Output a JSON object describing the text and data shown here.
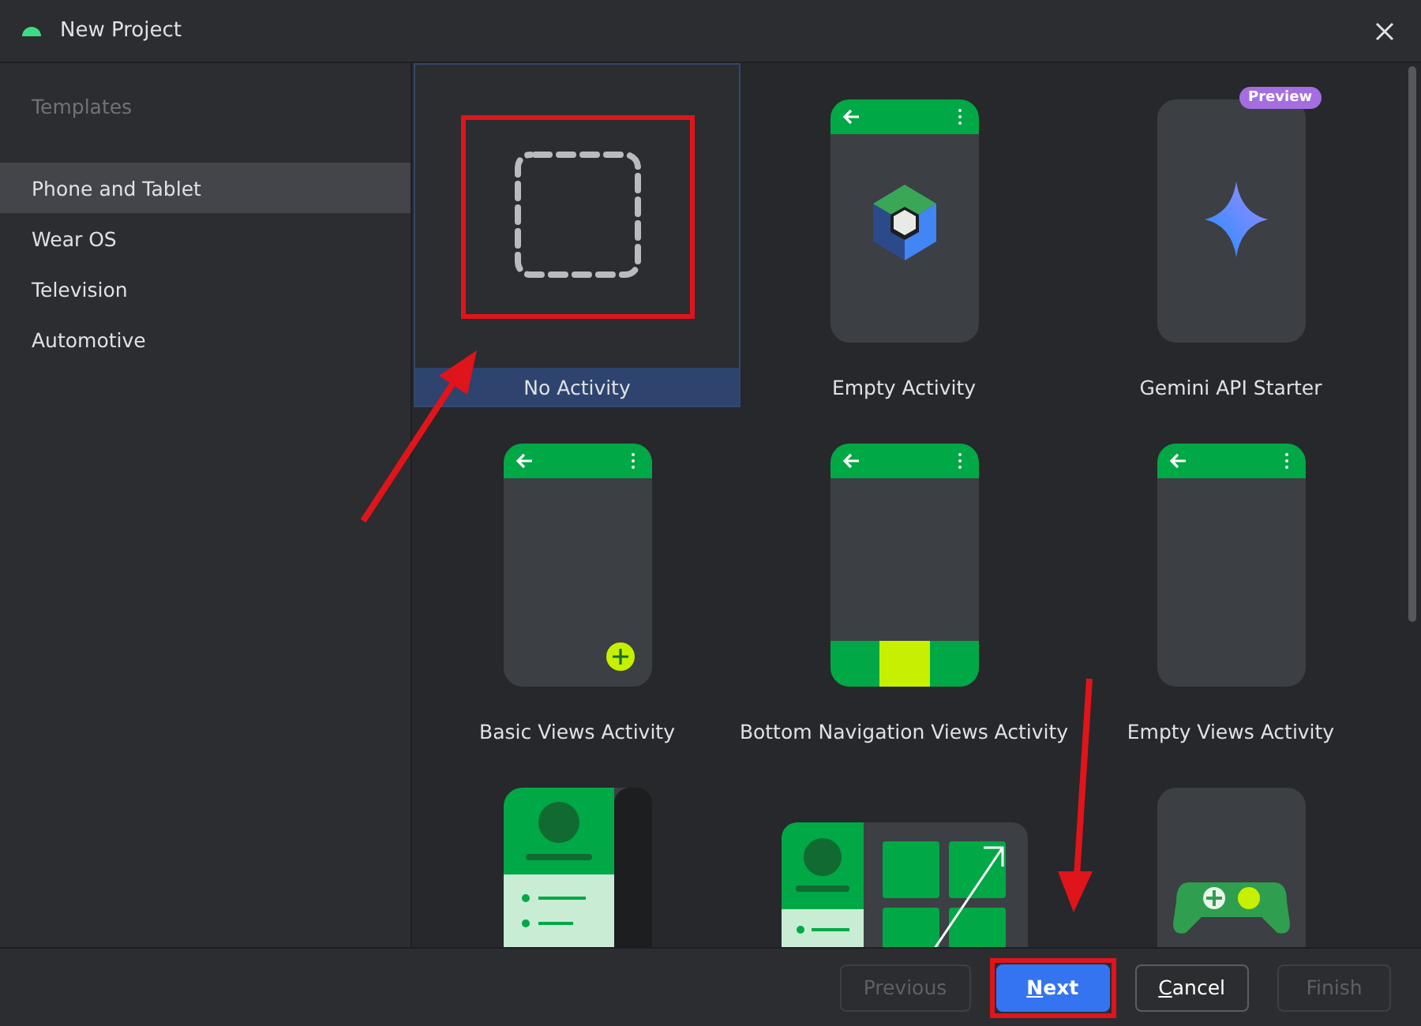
{
  "window": {
    "title": "New Project"
  },
  "sidebar": {
    "heading": "Templates",
    "items": [
      {
        "label": "Phone and Tablet",
        "selected": true
      },
      {
        "label": "Wear OS",
        "selected": false
      },
      {
        "label": "Television",
        "selected": false
      },
      {
        "label": "Automotive",
        "selected": false
      }
    ]
  },
  "templates": [
    {
      "kind": "none",
      "label": "No Activity",
      "selected": true,
      "highlighted": true
    },
    {
      "kind": "compose",
      "label": "Empty Activity",
      "selected": false,
      "highlighted": false
    },
    {
      "kind": "gemini",
      "label": "Gemini API Starter",
      "badge": "Preview",
      "selected": false,
      "highlighted": false
    },
    {
      "kind": "basic",
      "label": "Basic Views Activity",
      "selected": false,
      "highlighted": false
    },
    {
      "kind": "bottom-nav",
      "label": "Bottom Navigation Views Activity",
      "selected": false,
      "highlighted": false
    },
    {
      "kind": "empty-views",
      "label": "Empty Views Activity",
      "selected": false,
      "highlighted": false
    },
    {
      "kind": "nav-drawer",
      "selected": false,
      "highlighted": false
    },
    {
      "kind": "responsive",
      "selected": false,
      "highlighted": false
    },
    {
      "kind": "game",
      "selected": false,
      "highlighted": false
    }
  ],
  "buttons": [
    {
      "label": "Previous",
      "disabled": true,
      "default": false,
      "mnemonic": false,
      "highlighted": false
    },
    {
      "label": "Next",
      "disabled": false,
      "default": true,
      "mnemonic": true,
      "highlighted": true
    },
    {
      "label": "Cancel",
      "disabled": false,
      "default": false,
      "mnemonic": true,
      "highlighted": false
    },
    {
      "label": "Finish",
      "disabled": true,
      "default": false,
      "mnemonic": false,
      "highlighted": false
    }
  ]
}
